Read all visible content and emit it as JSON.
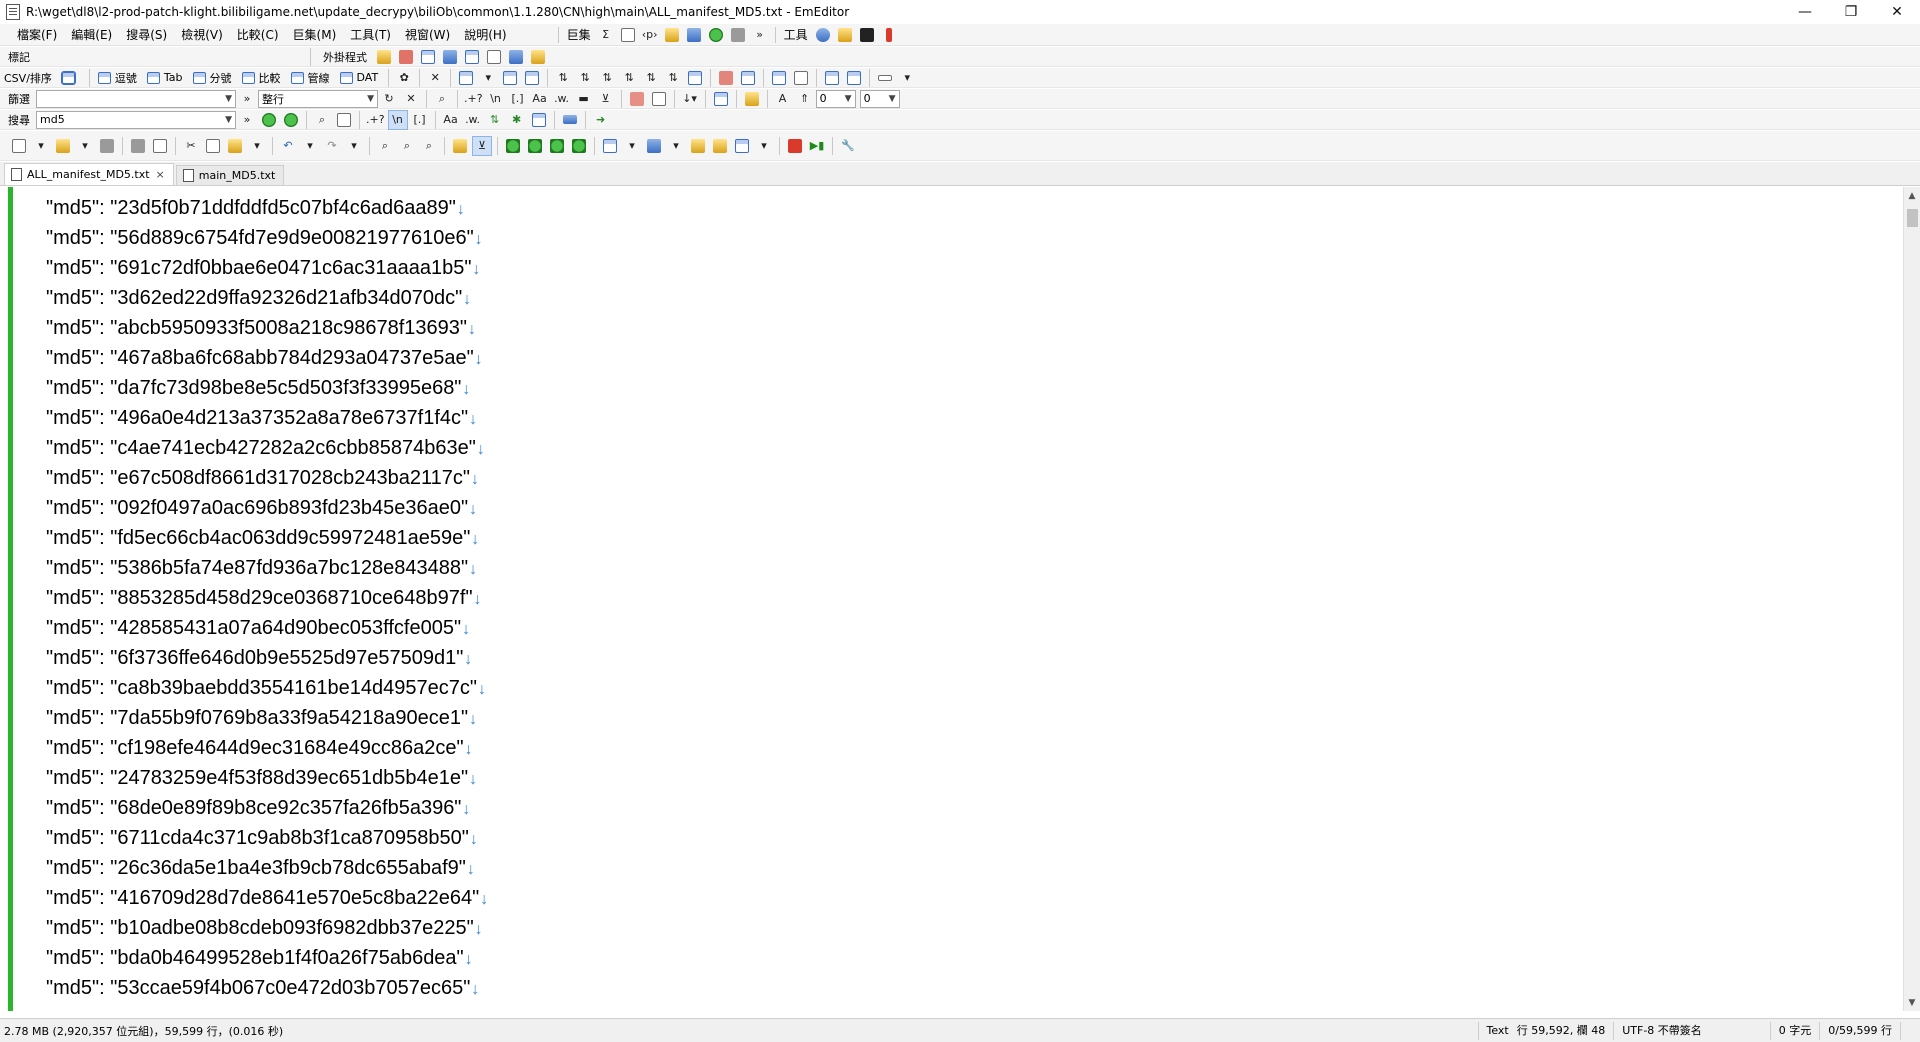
{
  "window": {
    "title": "R:\\wget\\dl8\\l2-prod-patch-klight.bilibiligame.net\\update_decrypy\\biliOb\\common\\1.1.280\\CN\\high\\main\\ALL_manifest_MD5.txt - EmEditor",
    "minimize": "—",
    "restore": "❐",
    "close": "✕"
  },
  "menu": {
    "items": [
      "檔案(F)",
      "編輯(E)",
      "搜尋(S)",
      "檢視(V)",
      "比較(C)",
      "巨集(M)",
      "工具(T)",
      "視窗(W)",
      "說明(H)"
    ],
    "macros_label": "巨集",
    "tools_label": "工具"
  },
  "toolbar_markers": {
    "label": "標記",
    "external_label": "外掛程式"
  },
  "toolbar_csv": {
    "buttons": [
      "CSV/排序",
      "逗號",
      "Tab",
      "分號",
      "比較",
      "管線",
      "DAT"
    ]
  },
  "toolbar_filter": {
    "label": "篩選",
    "filter_value": "",
    "wrap_value": "整行",
    "regex_toggle": ".+?",
    "newline_toggle": "\\n",
    "bracket_toggle": "[.]",
    "case_toggle": "Aa",
    "word_toggle": ".w.",
    "num1": "0",
    "num2": "0"
  },
  "toolbar_search": {
    "label": "搜尋",
    "search_value": "md5",
    "regex_toggle": ".+?",
    "newline_toggle": "\\n",
    "bracket_toggle": "[.]",
    "case_toggle": "Aa",
    "word_toggle": ".w."
  },
  "tabs": [
    {
      "label": "ALL_manifest_MD5.txt",
      "close": "×",
      "active": true
    },
    {
      "label": "main_MD5.txt",
      "active": false
    }
  ],
  "editor": {
    "newline_glyph": "↓",
    "lines": [
      "\"md5\": \"23d5f0b71ddfddfd5c07bf4c6ad6aa89\"",
      "\"md5\": \"56d889c6754fd7e9d9e00821977610e6\"",
      "\"md5\": \"691c72df0bbae6e0471c6ac31aaaa1b5\"",
      "\"md5\": \"3d62ed22d9ffa92326d21afb34d070dc\"",
      "\"md5\": \"abcb5950933f5008a218c98678f13693\"",
      "\"md5\": \"467a8ba6fc68abb784d293a04737e5ae\"",
      "\"md5\": \"da7fc73d98be8e5c5d503f3f33995e68\"",
      "\"md5\": \"496a0e4d213a37352a8a78e6737f1f4c\"",
      "\"md5\": \"c4ae741ecb427282a2c6cbb85874b63e\"",
      "\"md5\": \"e67c508df8661d317028cb243ba2117c\"",
      "\"md5\": \"092f0497a0ac696b893fd23b45e36ae0\"",
      "\"md5\": \"fd5ec66cb4ac063dd9c59972481ae59e\"",
      "\"md5\": \"5386b5fa74e87fd936a7bc128e843488\"",
      "\"md5\": \"8853285d458d29ce0368710ce648b97f\"",
      "\"md5\": \"428585431a07a64d90bec053ffcfe005\"",
      "\"md5\": \"6f3736ffe646d0b9e5525d97e57509d1\"",
      "\"md5\": \"ca8b39baebdd3554161be14d4957ec7c\"",
      "\"md5\": \"7da55b9f0769b8a33f9a54218a90ece1\"",
      "\"md5\": \"cf198efe4644d9ec31684e49cc86a2ce\"",
      "\"md5\": \"24783259e4f53f88d39ec651db5b4e1e\"",
      "\"md5\": \"68de0e89f89b8ce92c357fa26fb5a396\"",
      "\"md5\": \"6711cda4c371c9ab8b3f1ca870958b50\"",
      "\"md5\": \"26c36da5e1ba4e3fb9cb78dc655abaf9\"",
      "\"md5\": \"416709d28d7de8641e570e5c8ba22e64\"",
      "\"md5\": \"b10adbe08b8cdeb093f6982dbb37e225\"",
      "\"md5\": \"bda0b46499528eb1f4f0a26f75ab6dea\"",
      "\"md5\": \"53ccae59f4b067c0e472d03b7057ec65\""
    ]
  },
  "statusbar": {
    "left": "2.78 MB (2,920,357 位元組)，59,599 行，(0.016 秒)",
    "mode": "Text",
    "position": "行 59,592, 欄 48",
    "encoding": "UTF-8 不帶簽名",
    "chars": "0 字元",
    "lines": "0/59,599 行"
  },
  "colors": {
    "gutter": "#2cb52c",
    "newline": "#3b86d6",
    "toolbar_bg": "#f5f5f5"
  }
}
